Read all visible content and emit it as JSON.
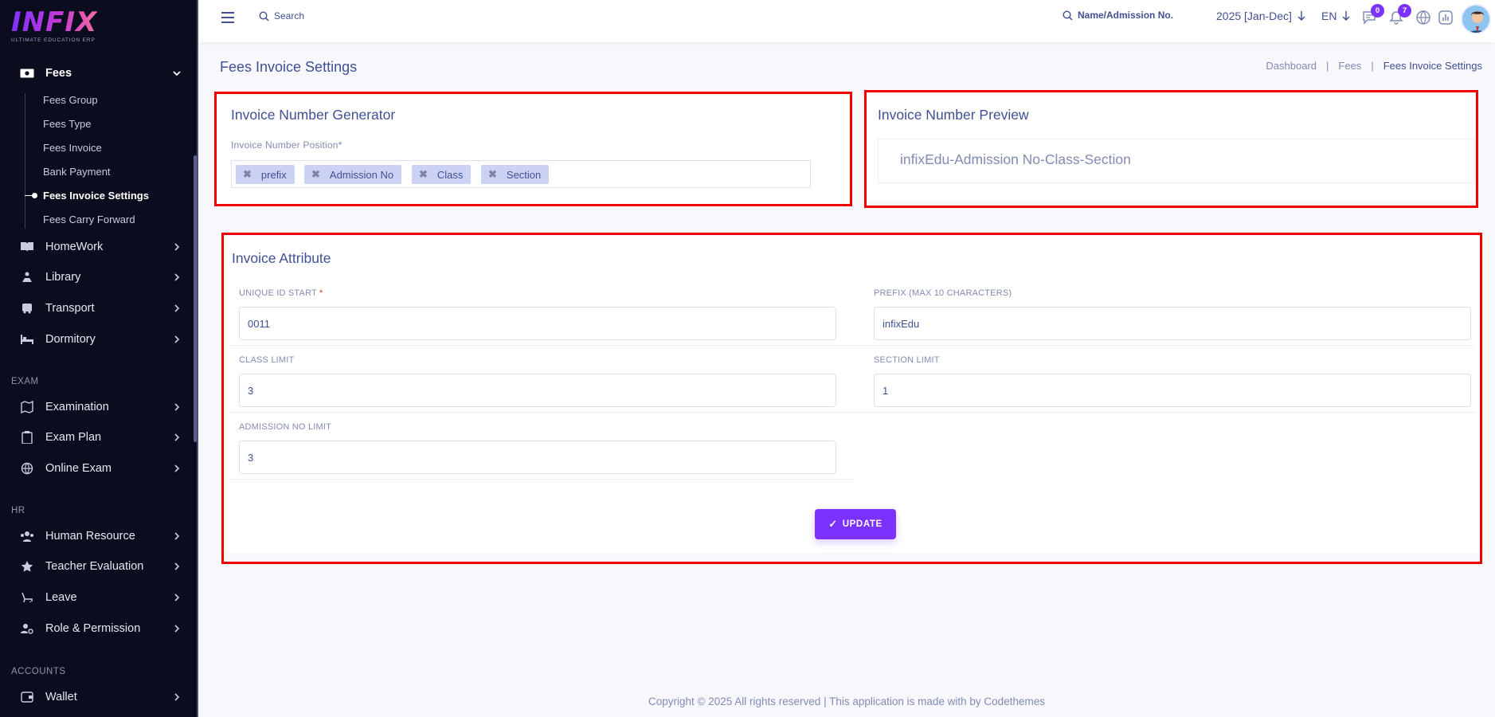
{
  "brand": {
    "logo": "INFIX",
    "tagline": "ULTIMATE EDUCATION ERP"
  },
  "sidebar": {
    "fees": {
      "label": "Fees"
    },
    "fees_sub": [
      "Fees Group",
      "Fees Type",
      "Fees Invoice",
      "Bank Payment",
      "Fees Invoice Settings",
      "Fees Carry Forward"
    ],
    "items": [
      "HomeWork",
      "Library",
      "Transport",
      "Dormitory"
    ],
    "exam_head": "EXAM",
    "exam_items": [
      "Examination",
      "Exam Plan",
      "Online Exam"
    ],
    "hr_head": "HR",
    "hr_items": [
      "Human Resource",
      "Teacher Evaluation",
      "Leave",
      "Role & Permission"
    ],
    "accounts_head": "ACCOUNTS",
    "accounts_items": [
      "Wallet"
    ]
  },
  "topbar": {
    "search_label": "Search",
    "student_search": "Name/Admission No.",
    "session": "2025 [Jan-Dec]",
    "language": "EN",
    "messages_count": "0",
    "notifications_count": "7"
  },
  "page": {
    "title": "Fees Invoice Settings",
    "breadcrumb": [
      "Dashboard",
      "Fees",
      "Fees Invoice Settings"
    ]
  },
  "generator": {
    "title": "Invoice Number Generator",
    "position_label": "Invoice Number Position*",
    "tags": [
      "prefix",
      "Admission No",
      "Class",
      "Section"
    ]
  },
  "preview": {
    "title": "Invoice Number Preview",
    "value": "infixEdu-Admission No-Class-Section"
  },
  "attribute": {
    "title": "Invoice Attribute",
    "unique_id_label": "UNIQUE ID START",
    "unique_id_req": "*",
    "unique_id_value": "0011",
    "prefix_label": "PREFIX (MAX 10 CHARACTERS)",
    "prefix_value": "infixEdu",
    "class_limit_label": "CLASS LIMIT",
    "class_limit_value": "3",
    "section_limit_label": "SECTION LIMIT",
    "section_limit_value": "1",
    "admission_limit_label": "ADMISSION NO LIMIT",
    "admission_limit_value": "3",
    "update_label": "UPDATE"
  },
  "footer": {
    "text": "Copyright © 2025 All rights reserved | This application is made with by Codethemes"
  },
  "colors": {
    "accent": "#7c32ff",
    "sidebar_bg": "#0b0d1e",
    "text": "#415094",
    "highlight": "#ee0000"
  }
}
